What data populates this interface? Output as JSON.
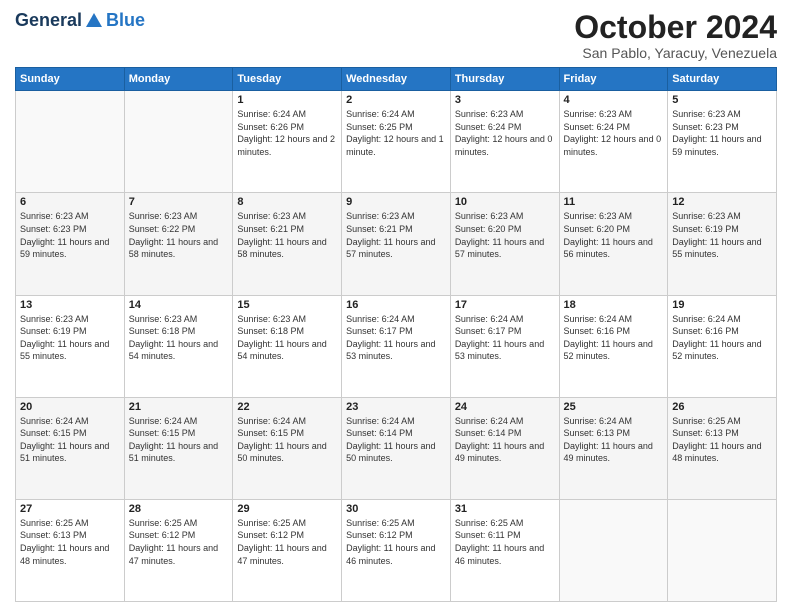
{
  "header": {
    "logo_general": "General",
    "logo_blue": "Blue",
    "month_title": "October 2024",
    "subtitle": "San Pablo, Yaracuy, Venezuela"
  },
  "days_of_week": [
    "Sunday",
    "Monday",
    "Tuesday",
    "Wednesday",
    "Thursday",
    "Friday",
    "Saturday"
  ],
  "weeks": [
    [
      {
        "day": "",
        "sunrise": "",
        "sunset": "",
        "daylight": ""
      },
      {
        "day": "",
        "sunrise": "",
        "sunset": "",
        "daylight": ""
      },
      {
        "day": "1",
        "sunrise": "Sunrise: 6:24 AM",
        "sunset": "Sunset: 6:26 PM",
        "daylight": "Daylight: 12 hours and 2 minutes."
      },
      {
        "day": "2",
        "sunrise": "Sunrise: 6:24 AM",
        "sunset": "Sunset: 6:25 PM",
        "daylight": "Daylight: 12 hours and 1 minute."
      },
      {
        "day": "3",
        "sunrise": "Sunrise: 6:23 AM",
        "sunset": "Sunset: 6:24 PM",
        "daylight": "Daylight: 12 hours and 0 minutes."
      },
      {
        "day": "4",
        "sunrise": "Sunrise: 6:23 AM",
        "sunset": "Sunset: 6:24 PM",
        "daylight": "Daylight: 12 hours and 0 minutes."
      },
      {
        "day": "5",
        "sunrise": "Sunrise: 6:23 AM",
        "sunset": "Sunset: 6:23 PM",
        "daylight": "Daylight: 11 hours and 59 minutes."
      }
    ],
    [
      {
        "day": "6",
        "sunrise": "Sunrise: 6:23 AM",
        "sunset": "Sunset: 6:23 PM",
        "daylight": "Daylight: 11 hours and 59 minutes."
      },
      {
        "day": "7",
        "sunrise": "Sunrise: 6:23 AM",
        "sunset": "Sunset: 6:22 PM",
        "daylight": "Daylight: 11 hours and 58 minutes."
      },
      {
        "day": "8",
        "sunrise": "Sunrise: 6:23 AM",
        "sunset": "Sunset: 6:21 PM",
        "daylight": "Daylight: 11 hours and 58 minutes."
      },
      {
        "day": "9",
        "sunrise": "Sunrise: 6:23 AM",
        "sunset": "Sunset: 6:21 PM",
        "daylight": "Daylight: 11 hours and 57 minutes."
      },
      {
        "day": "10",
        "sunrise": "Sunrise: 6:23 AM",
        "sunset": "Sunset: 6:20 PM",
        "daylight": "Daylight: 11 hours and 57 minutes."
      },
      {
        "day": "11",
        "sunrise": "Sunrise: 6:23 AM",
        "sunset": "Sunset: 6:20 PM",
        "daylight": "Daylight: 11 hours and 56 minutes."
      },
      {
        "day": "12",
        "sunrise": "Sunrise: 6:23 AM",
        "sunset": "Sunset: 6:19 PM",
        "daylight": "Daylight: 11 hours and 55 minutes."
      }
    ],
    [
      {
        "day": "13",
        "sunrise": "Sunrise: 6:23 AM",
        "sunset": "Sunset: 6:19 PM",
        "daylight": "Daylight: 11 hours and 55 minutes."
      },
      {
        "day": "14",
        "sunrise": "Sunrise: 6:23 AM",
        "sunset": "Sunset: 6:18 PM",
        "daylight": "Daylight: 11 hours and 54 minutes."
      },
      {
        "day": "15",
        "sunrise": "Sunrise: 6:23 AM",
        "sunset": "Sunset: 6:18 PM",
        "daylight": "Daylight: 11 hours and 54 minutes."
      },
      {
        "day": "16",
        "sunrise": "Sunrise: 6:24 AM",
        "sunset": "Sunset: 6:17 PM",
        "daylight": "Daylight: 11 hours and 53 minutes."
      },
      {
        "day": "17",
        "sunrise": "Sunrise: 6:24 AM",
        "sunset": "Sunset: 6:17 PM",
        "daylight": "Daylight: 11 hours and 53 minutes."
      },
      {
        "day": "18",
        "sunrise": "Sunrise: 6:24 AM",
        "sunset": "Sunset: 6:16 PM",
        "daylight": "Daylight: 11 hours and 52 minutes."
      },
      {
        "day": "19",
        "sunrise": "Sunrise: 6:24 AM",
        "sunset": "Sunset: 6:16 PM",
        "daylight": "Daylight: 11 hours and 52 minutes."
      }
    ],
    [
      {
        "day": "20",
        "sunrise": "Sunrise: 6:24 AM",
        "sunset": "Sunset: 6:15 PM",
        "daylight": "Daylight: 11 hours and 51 minutes."
      },
      {
        "day": "21",
        "sunrise": "Sunrise: 6:24 AM",
        "sunset": "Sunset: 6:15 PM",
        "daylight": "Daylight: 11 hours and 51 minutes."
      },
      {
        "day": "22",
        "sunrise": "Sunrise: 6:24 AM",
        "sunset": "Sunset: 6:15 PM",
        "daylight": "Daylight: 11 hours and 50 minutes."
      },
      {
        "day": "23",
        "sunrise": "Sunrise: 6:24 AM",
        "sunset": "Sunset: 6:14 PM",
        "daylight": "Daylight: 11 hours and 50 minutes."
      },
      {
        "day": "24",
        "sunrise": "Sunrise: 6:24 AM",
        "sunset": "Sunset: 6:14 PM",
        "daylight": "Daylight: 11 hours and 49 minutes."
      },
      {
        "day": "25",
        "sunrise": "Sunrise: 6:24 AM",
        "sunset": "Sunset: 6:13 PM",
        "daylight": "Daylight: 11 hours and 49 minutes."
      },
      {
        "day": "26",
        "sunrise": "Sunrise: 6:25 AM",
        "sunset": "Sunset: 6:13 PM",
        "daylight": "Daylight: 11 hours and 48 minutes."
      }
    ],
    [
      {
        "day": "27",
        "sunrise": "Sunrise: 6:25 AM",
        "sunset": "Sunset: 6:13 PM",
        "daylight": "Daylight: 11 hours and 48 minutes."
      },
      {
        "day": "28",
        "sunrise": "Sunrise: 6:25 AM",
        "sunset": "Sunset: 6:12 PM",
        "daylight": "Daylight: 11 hours and 47 minutes."
      },
      {
        "day": "29",
        "sunrise": "Sunrise: 6:25 AM",
        "sunset": "Sunset: 6:12 PM",
        "daylight": "Daylight: 11 hours and 47 minutes."
      },
      {
        "day": "30",
        "sunrise": "Sunrise: 6:25 AM",
        "sunset": "Sunset: 6:12 PM",
        "daylight": "Daylight: 11 hours and 46 minutes."
      },
      {
        "day": "31",
        "sunrise": "Sunrise: 6:25 AM",
        "sunset": "Sunset: 6:11 PM",
        "daylight": "Daylight: 11 hours and 46 minutes."
      },
      {
        "day": "",
        "sunrise": "",
        "sunset": "",
        "daylight": ""
      },
      {
        "day": "",
        "sunrise": "",
        "sunset": "",
        "daylight": ""
      }
    ]
  ]
}
